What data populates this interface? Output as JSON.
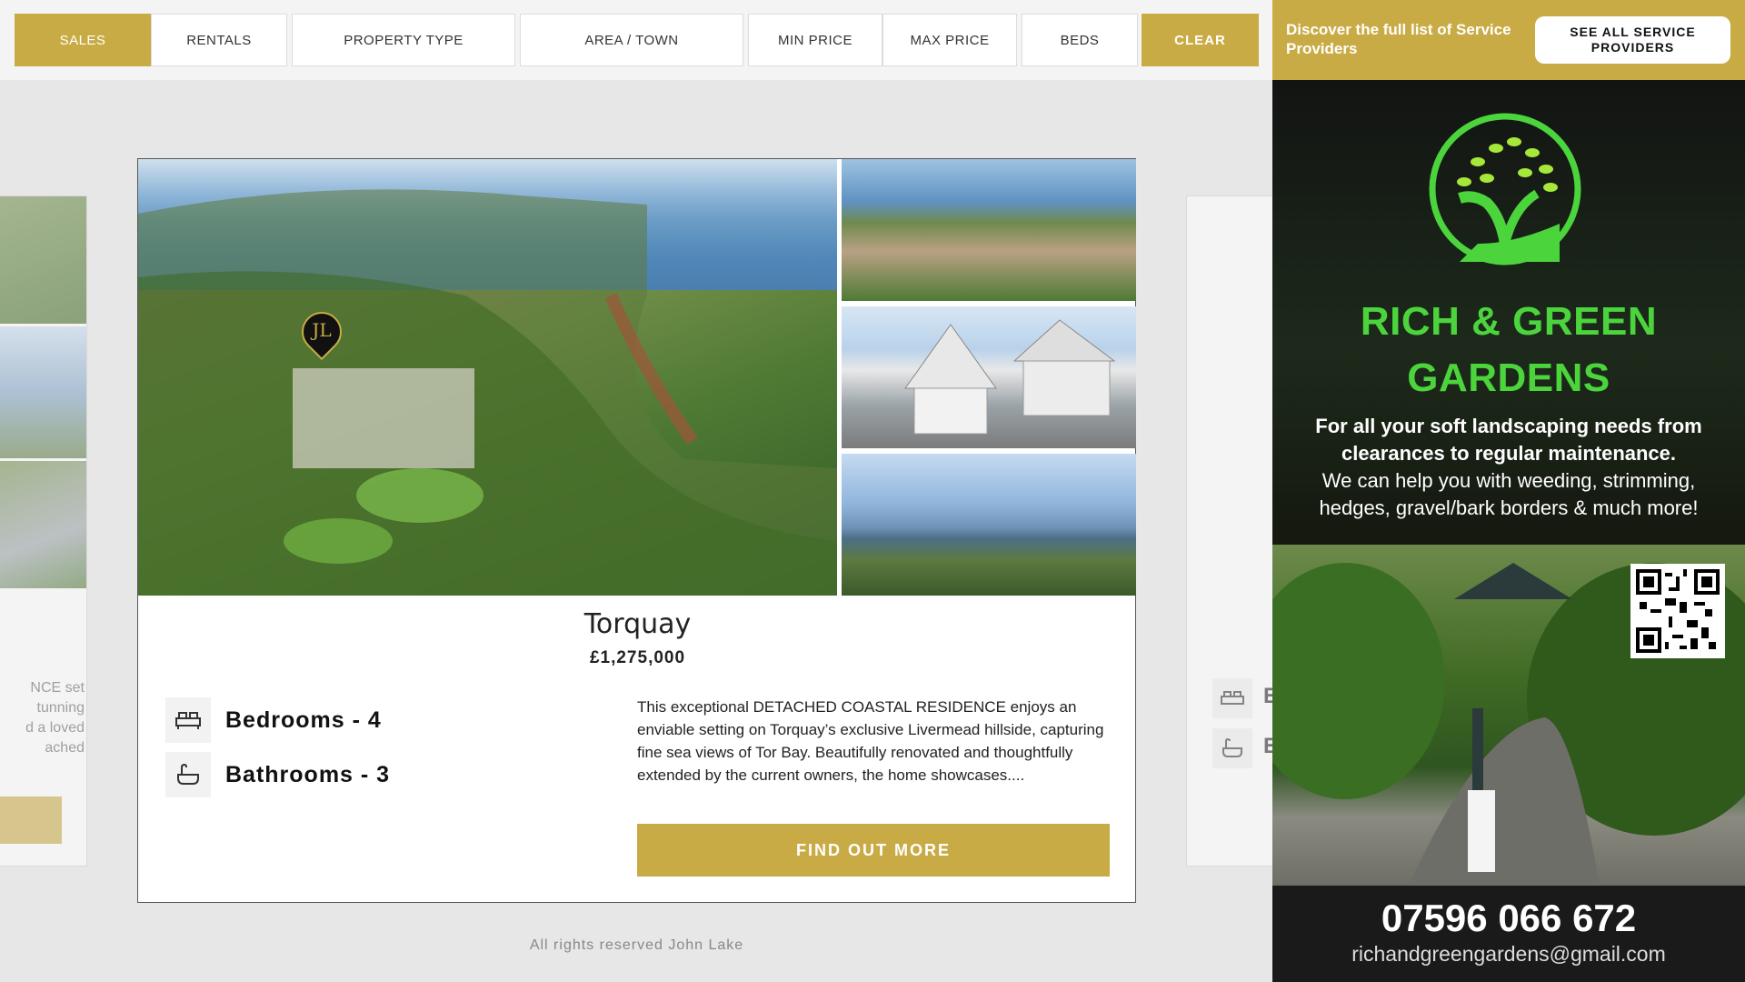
{
  "filters": {
    "sales": "SALES",
    "rentals": "RENTALS",
    "property_type": "PROPERTY TYPE",
    "area_town": "AREA / TOWN",
    "min_price": "MIN PRICE",
    "max_price": "MAX PRICE",
    "beds": "BEDS",
    "clear": "CLEAR"
  },
  "left_card": {
    "text_lines": [
      "NCE set",
      "tunning",
      "d a loved",
      "ached"
    ]
  },
  "right_card": {
    "bed_letter": "E",
    "bath_letter": "E"
  },
  "listing": {
    "pin_label": "JL",
    "town": "Torquay",
    "price": "£1,275,000",
    "bedrooms": "Bedrooms - 4",
    "bathrooms": "Bathrooms - 3",
    "description": "This exceptional DETACHED COASTAL RESIDENCE enjoys an enviable setting on Torquay’s exclusive Livermead hillside, capturing fine sea views of Tor Bay. Beautifully renovated and thoughtfully extended by the current owners, the home showcases....",
    "cta": "FIND OUT MORE"
  },
  "footer": {
    "rights": "All rights reserved John Lake"
  },
  "panel": {
    "discover": "Discover the full list of Service Providers",
    "see_all": "SEE ALL SERVICE PROVIDERS"
  },
  "ad": {
    "name_line1": "RICH & GREEN",
    "name_line2": "GARDENS",
    "tagline_bold_1": "For all your soft landscaping needs from",
    "tagline_bold_2": "clearances to regular maintenance.",
    "tagline_1": "We can help you with weeding, strimming,",
    "tagline_2": "hedges, gravel/bark borders & much more!",
    "phone": "07596 066 672",
    "email": "richandgreengardens@gmail.com"
  },
  "colors": {
    "accent_gold": "#c9ab45",
    "ad_green": "#4cd43d"
  }
}
